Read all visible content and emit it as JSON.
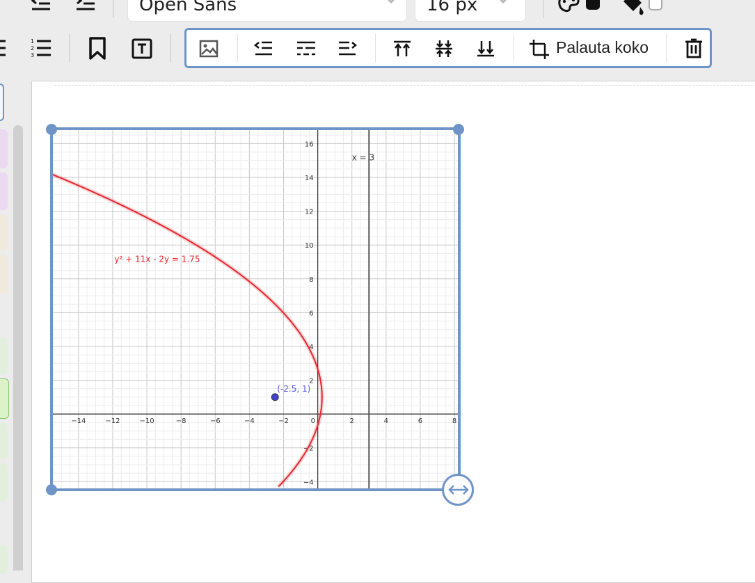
{
  "toolbar": {
    "font_family": "Open Sans",
    "font_size": "16 px"
  },
  "image_toolbar": {
    "reset_size_label": "Palauta koko"
  },
  "colors": {
    "accent": "#6e94c8",
    "curve": "#e8262f",
    "point": "#4444c8",
    "vertical_line": "#555555"
  },
  "icons": {
    "outdent": "outdent-icon",
    "indent": "indent-icon",
    "palette": "palette-icon",
    "fill": "fill-bucket-icon",
    "bulleted_list": "bulleted-list-icon",
    "numbered_list": "numbered-list-icon",
    "bookmark": "bookmark-icon",
    "text_box": "text-box-icon",
    "image": "image-icon",
    "align_left": "wrap-left-icon",
    "align_inline": "wrap-inline-icon",
    "align_right": "wrap-right-icon",
    "align_top": "align-top-icon",
    "align_middle": "align-middle-icon",
    "align_bottom": "align-bottom-icon",
    "crop": "crop-icon",
    "delete": "trash-icon",
    "resize": "resize-horizontal-icon"
  },
  "chart_data": {
    "type": "line",
    "xlim": [
      -15.5,
      8.2
    ],
    "ylim": [
      -4.4,
      16.8
    ],
    "grid": true,
    "x_ticks": [
      -14,
      -12,
      -10,
      -8,
      -6,
      -4,
      -2,
      0,
      2,
      4,
      6,
      8
    ],
    "y_ticks": [
      -4,
      -2,
      2,
      4,
      6,
      8,
      10,
      12,
      14,
      16
    ],
    "curve": {
      "label": "y² + 11x - 2y = 1.75",
      "label_pos": [
        -11.9,
        9.0
      ],
      "equation": {
        "a": 11,
        "b": -2,
        "c": 1.75
      },
      "y_range": [
        -4.3,
        15.3
      ]
    },
    "vertical_line": {
      "x": 3,
      "label": "x = 3",
      "label_pos": [
        2,
        15
      ]
    },
    "point": {
      "x": -2.5,
      "y": 1,
      "label": "(-2.5, 1)"
    }
  }
}
